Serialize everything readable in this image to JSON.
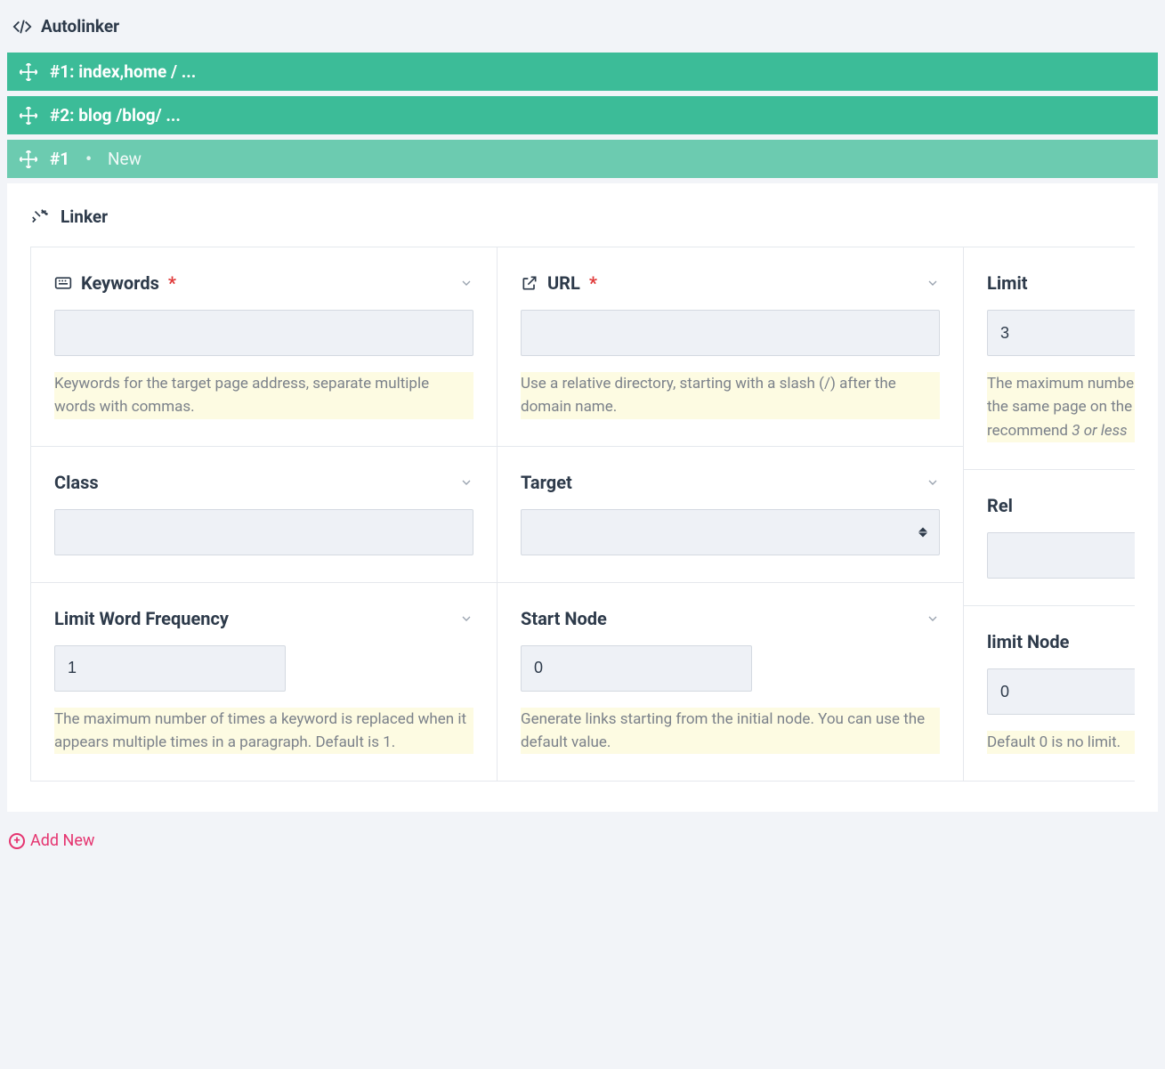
{
  "header": {
    "title": "Autolinker"
  },
  "bars": [
    {
      "label": "#1: index,home / ..."
    },
    {
      "label": "#2: blog /blog/ ..."
    }
  ],
  "expanded_bar": {
    "prefix": "#1",
    "suffix": "New"
  },
  "panel_title": "Linker",
  "fields": {
    "keywords": {
      "label": "Keywords",
      "required": true,
      "value": "",
      "help": "Keywords for the target page address, separate multiple words with commas."
    },
    "url": {
      "label": "URL",
      "required": true,
      "value": "",
      "help": "Use a relative directory, starting with a slash (/) after the domain name."
    },
    "limit": {
      "label": "Limit",
      "value": "3",
      "help_prefix": "The maximum number of links to the same page on the page, recommend ",
      "help_em": "3 or less"
    },
    "class": {
      "label": "Class",
      "value": ""
    },
    "target": {
      "label": "Target",
      "value": ""
    },
    "rel": {
      "label": "Rel",
      "value": ""
    },
    "limit_word_freq": {
      "label": "Limit Word Frequency",
      "value": "1",
      "help": "The maximum number of times a keyword is replaced when it appears multiple times in a paragraph. Default is 1."
    },
    "start_node": {
      "label": "Start Node",
      "value": "0",
      "help": "Generate links starting from the initial node. You can use the default value."
    },
    "limit_node": {
      "label": "limit Node",
      "value": "0",
      "help": "Default 0 is no limit."
    }
  },
  "add_new_label": "Add New"
}
